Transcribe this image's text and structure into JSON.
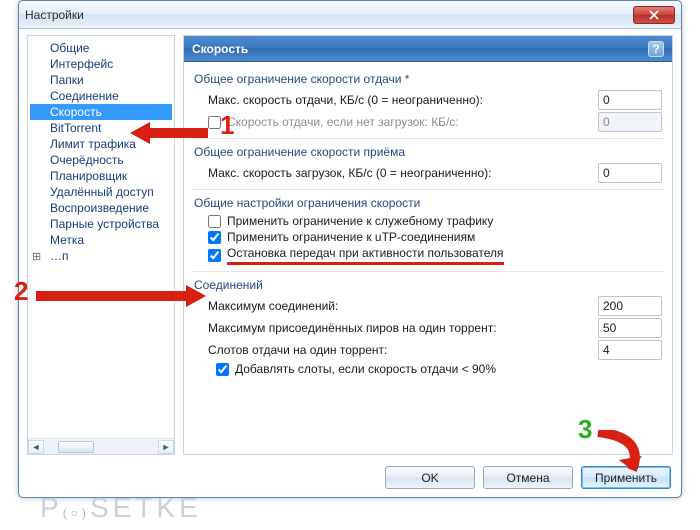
{
  "window": {
    "title": "Настройки"
  },
  "sidebar": {
    "items": [
      {
        "label": "Общие"
      },
      {
        "label": "Интерфейс"
      },
      {
        "label": "Папки"
      },
      {
        "label": "Соединение"
      },
      {
        "label": "Скорость",
        "selected": true
      },
      {
        "label": "BitTorrent"
      },
      {
        "label": "Лимит трафика"
      },
      {
        "label": "Очерёдность"
      },
      {
        "label": "Планировщик"
      },
      {
        "label": "Удалённый доступ"
      },
      {
        "label": "Воспроизведение"
      },
      {
        "label": "Парные устройства"
      },
      {
        "label": "Метка"
      },
      {
        "label": "…п",
        "expandable": true
      }
    ]
  },
  "panel": {
    "title": "Скорость",
    "help": "?",
    "upload": {
      "group": "Общее ограничение скорости отдачи *",
      "rate_label": "Макс. скорость отдачи, КБ/с (0 = неограниченно):",
      "rate_value": "0",
      "alt_label": "Скорость отдачи, если нет загрузок: КБ/с:",
      "alt_checked": false,
      "alt_value": "0"
    },
    "download": {
      "group": "Общее ограничение скорости приёма",
      "rate_label": "Макс. скорость загрузок, КБ/с (0 = неограниченно):",
      "rate_value": "0"
    },
    "limits": {
      "group": "Общие настройки ограничения скорости",
      "overhead_label": "Применить ограничение к служебному трафику",
      "overhead_checked": false,
      "utp_label": "Применить ограничение к uTP-соединениям",
      "utp_checked": true,
      "stop_label": "Остановка передач при активности пользователя",
      "stop_checked": true
    },
    "conn": {
      "group": "Соединений",
      "max_conn_label": "Максимум соединений:",
      "max_conn_value": "200",
      "max_peers_label": "Максимум присоединённых пиров на один торрент:",
      "max_peers_value": "50",
      "slots_label": "Слотов отдачи на один торрент:",
      "slots_value": "4",
      "addslots_label": "Добавлять слоты, если скорость отдачи < 90%",
      "addslots_checked": true
    }
  },
  "buttons": {
    "ok": "OK",
    "cancel": "Отмена",
    "apply": "Применить"
  },
  "annotations": {
    "n1": "1",
    "n2": "2",
    "n3": "3"
  },
  "watermark": "P  SETKE"
}
